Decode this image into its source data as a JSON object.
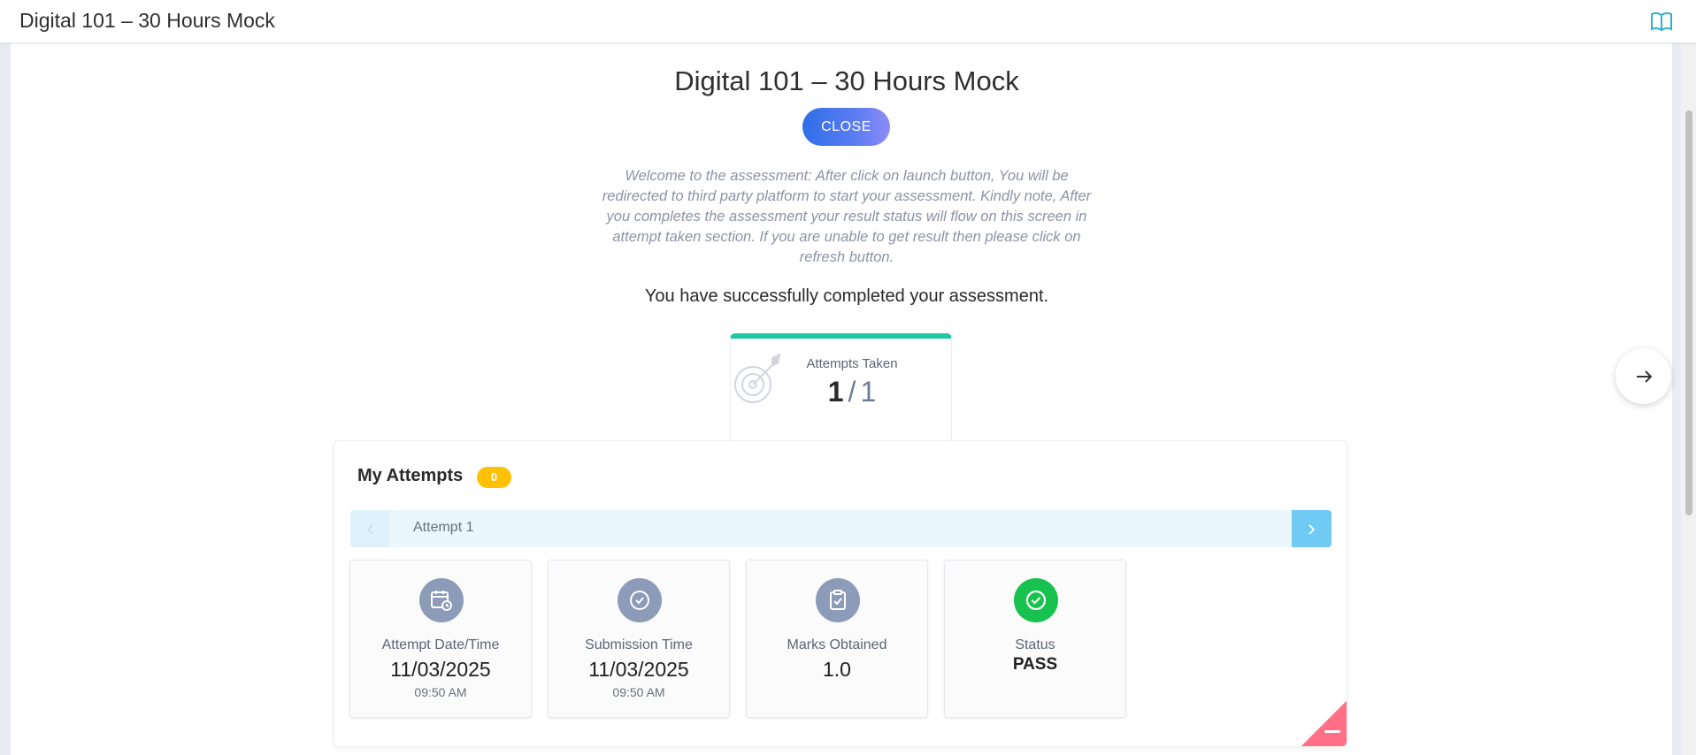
{
  "window": {
    "title": "Digital 101 – 30 Hours Mock"
  },
  "page": {
    "title": "Digital 101 – 30 Hours Mock",
    "close_label": "CLOSE",
    "welcome_text": "Welcome to the assessment: After click on launch button, You will be redirected to third party platform to start your assessment. Kindly note, After you completes the assessment your result status will flow on this screen in attempt taken section. If you are unable to get result then please click on refresh button.",
    "success_text": "You have successfully completed your assessment."
  },
  "attempts_summary": {
    "label": "Attempts Taken",
    "taken": "1",
    "separator": "/",
    "total": "1"
  },
  "my_attempts": {
    "title": "My Attempts",
    "badge": "0",
    "current_attempt_label": "Attempt 1",
    "cards": [
      {
        "label": "Attempt Date/Time",
        "value": "11/03/2025",
        "sub": "09:50 AM",
        "icon": "calendar-clock-icon"
      },
      {
        "label": "Submission Time",
        "value": "11/03/2025",
        "sub": "09:50 AM",
        "icon": "clock-check-icon"
      },
      {
        "label": "Marks Obtained",
        "value": "1.0",
        "icon": "clipboard-check-icon"
      },
      {
        "label": "Status",
        "value": "PASS",
        "icon": "check-circle-icon"
      }
    ]
  },
  "colors": {
    "accent_gradient_start": "#2f6fe8",
    "accent_gradient_end": "#8c8cf5",
    "tab_top_border": "#1fc8a0",
    "badge_bg": "#ffc107",
    "status_pass": "#17c24e",
    "icon_bg": "#8c9bb8",
    "corner": "#ff6f86"
  }
}
